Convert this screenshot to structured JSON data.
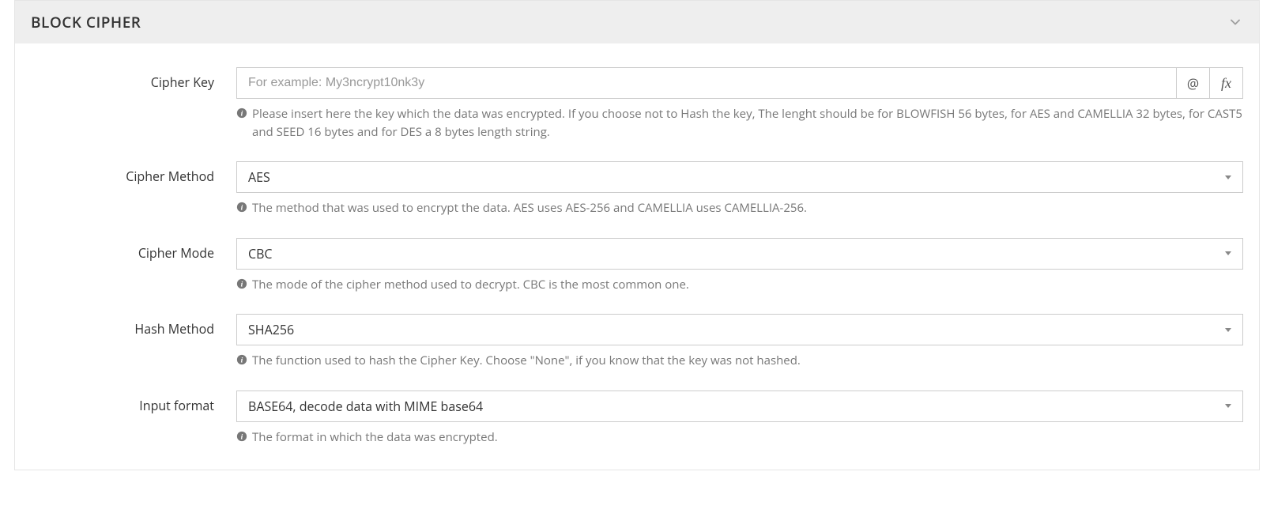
{
  "panel": {
    "title": "BLOCK CIPHER"
  },
  "fields": {
    "cipher_key": {
      "label": "Cipher Key",
      "placeholder": "For example: My3ncrypt10nk3y",
      "value": "",
      "help": "Please insert here the key which the data was encrypted. If you choose not to Hash the key, The lenght should be for BLOWFISH 56 bytes, for AES and CAMELLIA 32 bytes, for CAST5 and SEED 16 bytes and for DES a 8 bytes length string."
    },
    "cipher_method": {
      "label": "Cipher Method",
      "value": "AES",
      "help": "The method that was used to encrypt the data. AES uses AES-256 and CAMELLIA uses CAMELLIA-256."
    },
    "cipher_mode": {
      "label": "Cipher Mode",
      "value": "CBC",
      "help": "The mode of the cipher method used to decrypt. CBC is the most common one."
    },
    "hash_method": {
      "label": "Hash Method",
      "value": "SHA256",
      "help": "The function used to hash the Cipher Key. Choose \"None\", if you know that the key was not hashed."
    },
    "input_format": {
      "label": "Input format",
      "value": "BASE64, decode data with MIME base64",
      "help": "The format in which the data was encrypted."
    }
  },
  "addons": {
    "at": "@",
    "fx": "fx"
  }
}
